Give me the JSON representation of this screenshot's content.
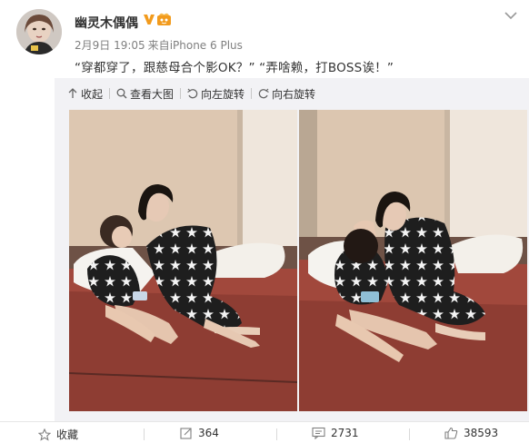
{
  "user": {
    "name": "幽灵木偶偶"
  },
  "meta": {
    "date": "2月9日 19:05",
    "source_prefix": "来自",
    "source": "iPhone 6 Plus"
  },
  "post": {
    "text": "“穿都穿了，跟慈母合个影OK？” “弄啥赖，打BOSS诶！”"
  },
  "toolbar": {
    "collapse_label": "收起",
    "view_large_label": "查看大图",
    "rotate_left_label": "向左旋转",
    "rotate_right_label": "向右旋转"
  },
  "actions": {
    "favorite_label": "收藏",
    "repost_count": "364",
    "comment_count": "2731",
    "like_count": "38593"
  },
  "colors": {
    "accent_orange": "#f29b1d",
    "link_blue": "#3c6eb4",
    "muted": "#808080"
  }
}
